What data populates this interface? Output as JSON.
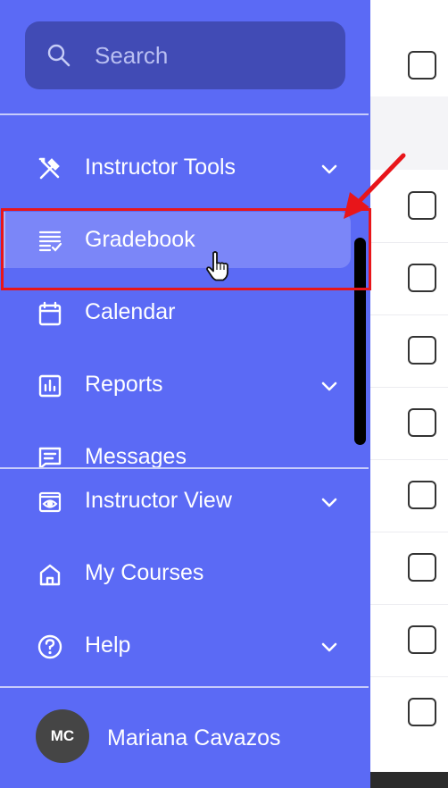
{
  "search": {
    "placeholder": "Search"
  },
  "nav": {
    "items": [
      {
        "label": "Instructor Tools",
        "icon": "tools-icon",
        "has_chevron": true
      },
      {
        "label": "Gradebook",
        "icon": "gradebook-icon",
        "has_chevron": false,
        "active": true
      },
      {
        "label": "Calendar",
        "icon": "calendar-icon",
        "has_chevron": false
      },
      {
        "label": "Reports",
        "icon": "reports-icon",
        "has_chevron": true
      },
      {
        "label": "Messages",
        "icon": "messages-icon",
        "has_chevron": false
      }
    ],
    "secondary": [
      {
        "label": "Instructor View",
        "icon": "eye-icon",
        "has_chevron": true
      },
      {
        "label": "My Courses",
        "icon": "home-icon",
        "has_chevron": false
      },
      {
        "label": "Help",
        "icon": "help-icon",
        "has_chevron": true
      }
    ]
  },
  "user": {
    "initials": "MC",
    "name": "Mariana Cavazos"
  },
  "colors": {
    "sidebar": "#5b6af5",
    "search_bg": "#414bb5",
    "active_item": "#7b86f8",
    "annotation": "#e8151a"
  }
}
